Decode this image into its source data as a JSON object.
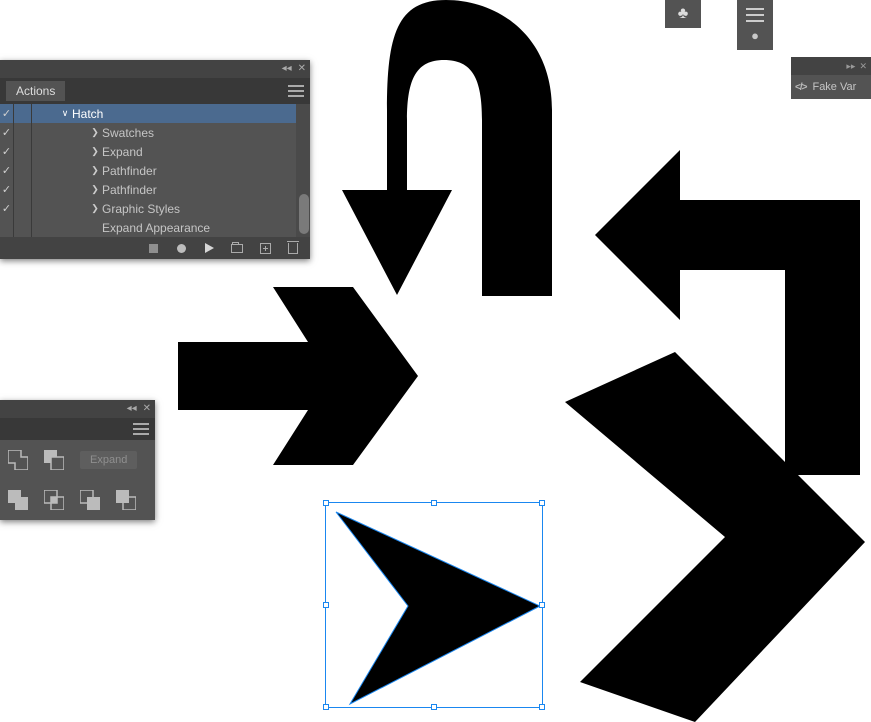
{
  "toolbar": {
    "club_glyph": "♣",
    "sphere_glyph": "●"
  },
  "fakevar": {
    "label": "Fake Var",
    "code_glyph": "</>"
  },
  "actions_panel": {
    "tab": "Actions",
    "group": "Hatch",
    "items": [
      {
        "label": "Swatches"
      },
      {
        "label": "Expand"
      },
      {
        "label": "Pathfinder"
      },
      {
        "label": "Pathfinder"
      },
      {
        "label": "Graphic Styles"
      },
      {
        "label": "Expand Appearance"
      }
    ]
  },
  "pathfinder_panel": {
    "expand_label": "Expand"
  }
}
